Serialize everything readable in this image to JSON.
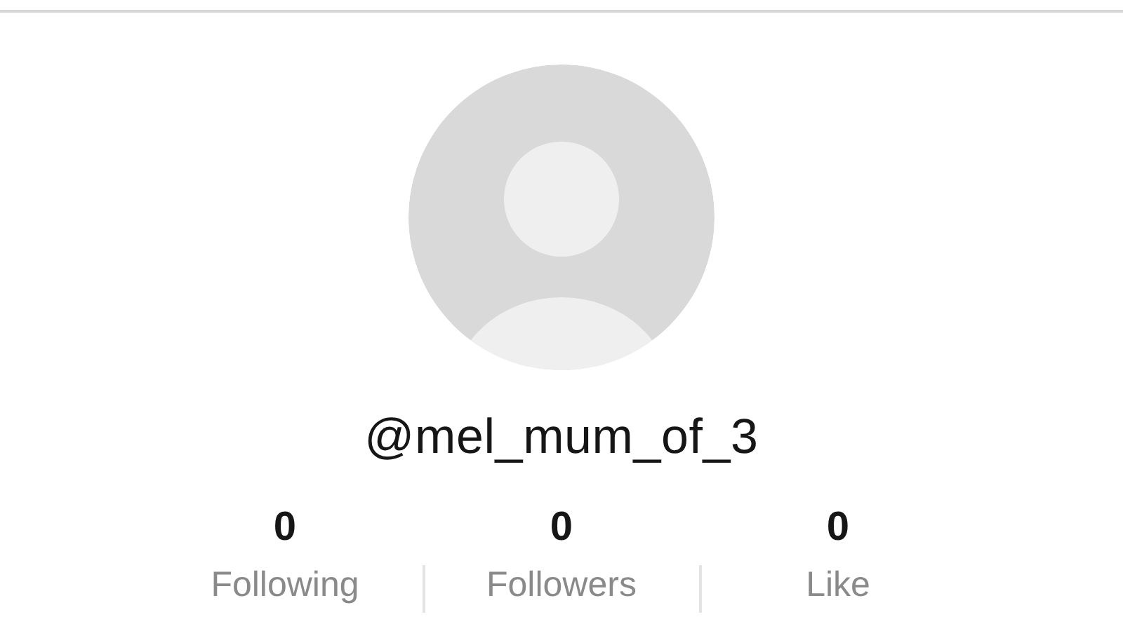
{
  "username": "@mel_mum_of_3",
  "stats": [
    {
      "count": "0",
      "label": "Following"
    },
    {
      "count": "0",
      "label": "Followers"
    },
    {
      "count": "0",
      "label": "Like"
    }
  ]
}
